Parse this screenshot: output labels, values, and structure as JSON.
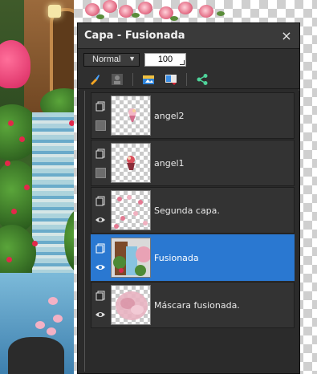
{
  "panel": {
    "title": "Capa - Fusionada",
    "close_glyph": "×"
  },
  "controls": {
    "blend_mode": "Normal",
    "opacity": "100"
  },
  "toolbar": {
    "icons": [
      "paint-brush-icon",
      "mask-icon",
      "layer-effects-icon",
      "adjustment-icon",
      "link-icon"
    ]
  },
  "layers": [
    {
      "name": "angel2",
      "visible": false,
      "selected": false
    },
    {
      "name": "angel1",
      "visible": false,
      "selected": false
    },
    {
      "name": "Segunda capa.",
      "visible": true,
      "selected": false
    },
    {
      "name": "Fusionada",
      "visible": true,
      "selected": true
    },
    {
      "name": "Máscara fusionada.",
      "visible": true,
      "selected": false
    }
  ],
  "colors": {
    "panel_bg": "#2b2b2b",
    "row_bg": "#333333",
    "selected_bg": "#2a78d1",
    "text": "#e9e9e9"
  }
}
